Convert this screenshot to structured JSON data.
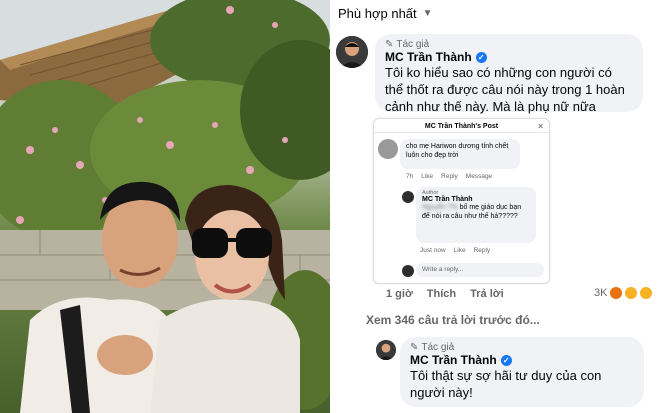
{
  "sort": {
    "label": "Phù hợp nhất"
  },
  "main_comment": {
    "tag": "Tác giả",
    "author": "MC Trần Thành",
    "text": "Tôi ko hiểu sao có những con người có thể thốt ra được câu nói này trong 1 hoàn cảnh như thế này. Mà là phụ nữ nữa chứ!!!!",
    "actions": {
      "time": "1 giờ",
      "like": "Thích",
      "reply": "Trả lời"
    },
    "reactions": {
      "count": "3K"
    }
  },
  "embedded_post": {
    "title": "MC Trần Thành's Post",
    "first_comment": {
      "text": "cho mẹ Hariwon dương tính chết luôn cho đẹp trời",
      "actions": {
        "time": "7h",
        "like": "Like",
        "reply": "Reply",
        "message": "Message"
      }
    },
    "reply": {
      "tag": "Author",
      "author": "MC Trần Thành",
      "blurred_name": "Nguyễn Thị",
      "text": "bố mẹ giáo dục bạn để nói ra câu như thế hả?????",
      "actions": {
        "time": "Just now",
        "like": "Like",
        "reply": "Reply"
      }
    },
    "reply_input": {
      "placeholder": "Write a reply..."
    }
  },
  "view_more": {
    "label": "Xem 346 câu trả lời trước đó..."
  },
  "second_comment": {
    "tag": "Tác giả",
    "author": "MC Trần Thành",
    "text": "Tôi thật sự sợ hãi tư duy của con người này!"
  },
  "colors": {
    "bubble": "#f0f2f5",
    "verified": "#1877f2",
    "muted": "#65676b"
  }
}
